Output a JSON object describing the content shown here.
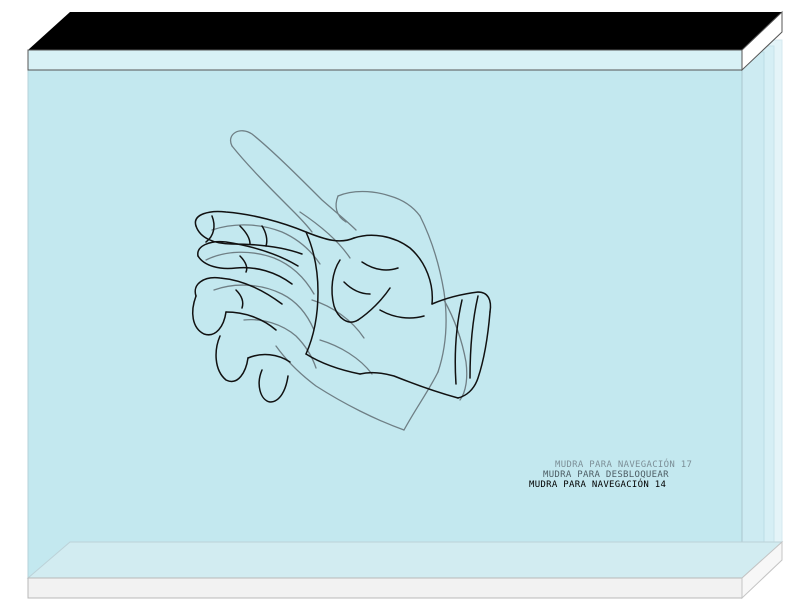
{
  "colors": {
    "panel_fill": "#c3e8ef",
    "panel_edge": "#9fb6bd",
    "top_face": "#000000",
    "bottom_face": "#f2f2f2",
    "hand_stroke_front": "#111111",
    "hand_stroke_back": "#6f7f85"
  },
  "captions": [
    {
      "text": "MUDRA PARA NAVEGACIÓN 17"
    },
    {
      "text": "MUDRA PARA DESBLOQUEAR"
    },
    {
      "text": "MUDRA PARA NAVEGACIÓN 14"
    }
  ]
}
